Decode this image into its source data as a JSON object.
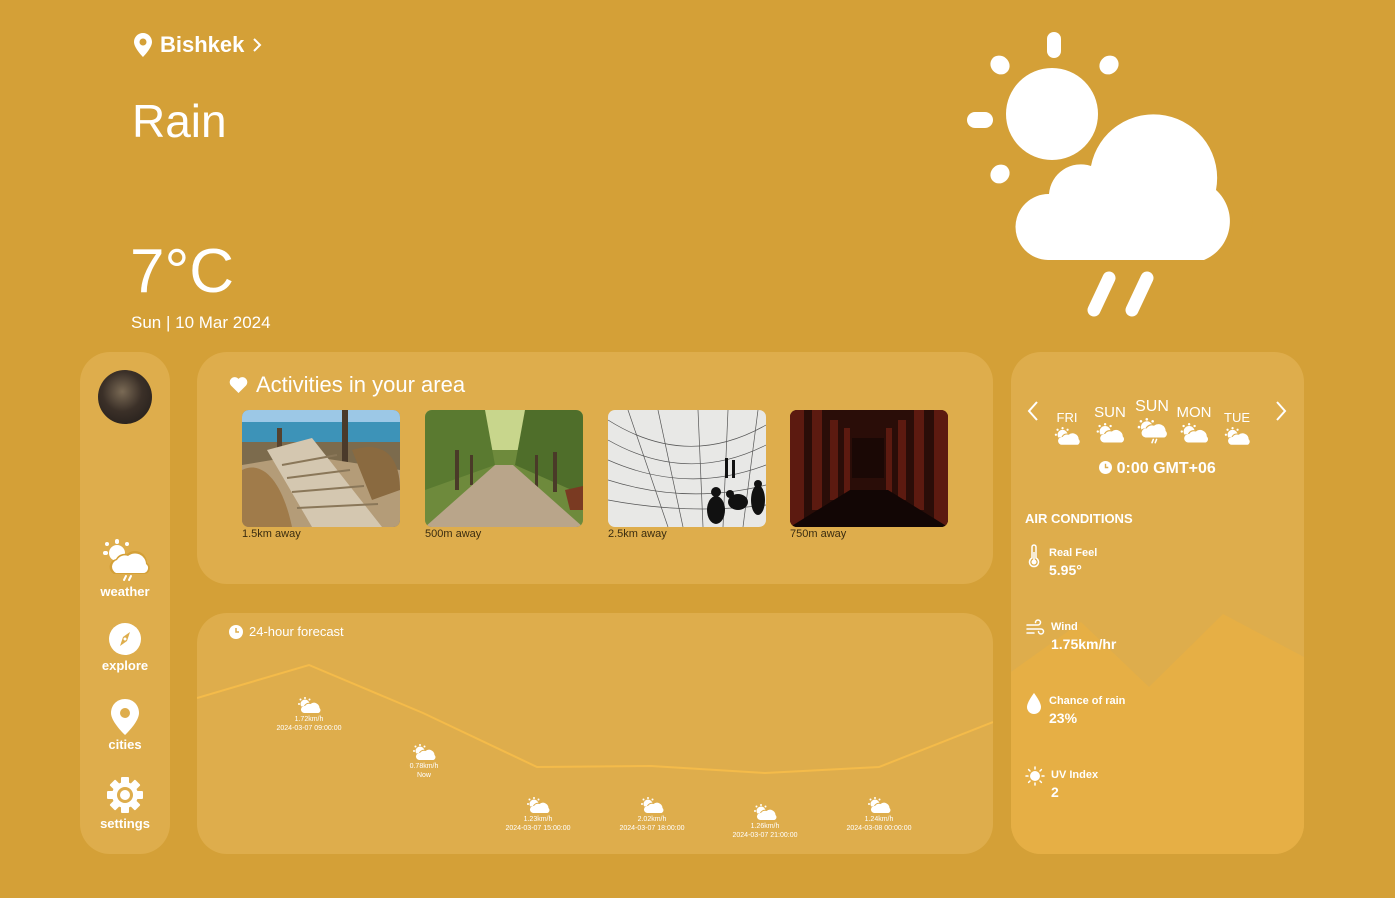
{
  "header": {
    "city": "Bishkek",
    "condition": "Rain",
    "temperature": "7°C",
    "date": "Sun | 10 Mar 2024"
  },
  "sidebar": {
    "items": [
      {
        "label": "weather",
        "icon": "weather-icon"
      },
      {
        "label": "explore",
        "icon": "compass-icon"
      },
      {
        "label": "cities",
        "icon": "map-pin-icon"
      },
      {
        "label": "settings",
        "icon": "gear-icon"
      }
    ]
  },
  "activities": {
    "title": "Activities in your area",
    "items": [
      {
        "distance": "1.5km away"
      },
      {
        "distance": "500m away"
      },
      {
        "distance": "2.5km away"
      },
      {
        "distance": "750m away"
      }
    ]
  },
  "forecast": {
    "title": "24-hour forecast",
    "points": [
      {
        "wind": "1.72km/h",
        "time": "2024-03-07 09:00:00"
      },
      {
        "wind": "0.78km/h",
        "time": "Now"
      },
      {
        "wind": "1.23km/h",
        "time": "2024-03-07 15:00:00"
      },
      {
        "wind": "2.02km/h",
        "time": "2024-03-07 18:00:00"
      },
      {
        "wind": "1.26km/h",
        "time": "2024-03-07 21:00:00"
      },
      {
        "wind": "1.24km/h",
        "time": "2024-03-08 00:00:00"
      }
    ]
  },
  "week": {
    "days": [
      {
        "label": "FRI",
        "icon": "partly-cloudy-icon"
      },
      {
        "label": "SUN",
        "icon": "partly-cloudy-icon"
      },
      {
        "label": "SUN",
        "icon": "rain-icon",
        "active": true
      },
      {
        "label": "MON",
        "icon": "partly-cloudy-icon"
      },
      {
        "label": "TUE",
        "icon": "partly-cloudy-icon"
      }
    ],
    "time": "0:00 GMT+06"
  },
  "air": {
    "title": "AIR CONDITIONS",
    "items": [
      {
        "label": "Real Feel",
        "value": "5.95°",
        "icon": "thermometer-icon"
      },
      {
        "label": "Wind",
        "value": "1.75km/hr",
        "icon": "wind-icon"
      },
      {
        "label": "Chance of rain",
        "value": "23%",
        "icon": "droplet-icon"
      },
      {
        "label": "UV Index",
        "value": "2",
        "icon": "sun-icon"
      }
    ]
  },
  "colors": {
    "background": "#D4A037",
    "panel": "#DEAD4C",
    "line": "#F4BB4A"
  }
}
